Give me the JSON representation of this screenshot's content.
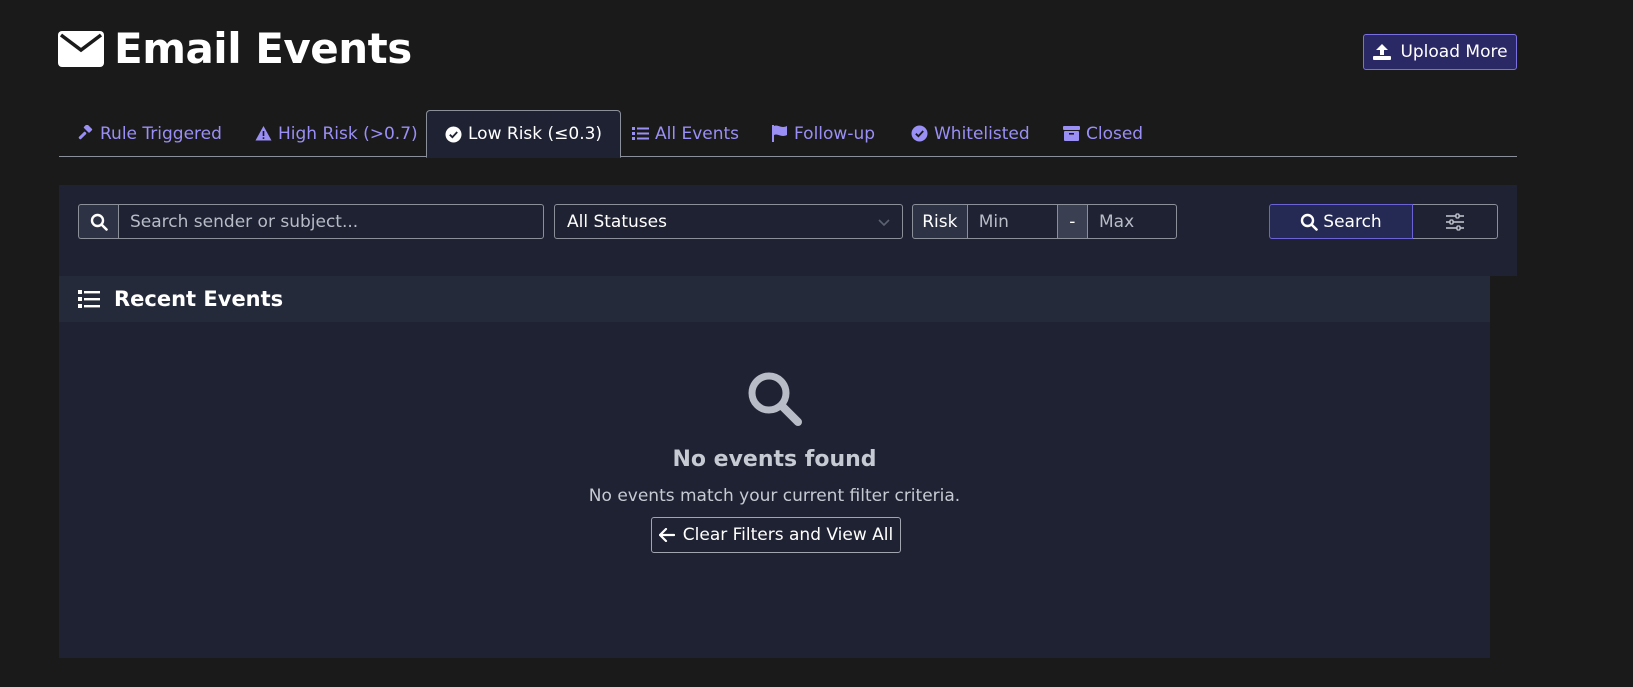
{
  "page": {
    "title": "Email Events",
    "upload_button": "Upload More"
  },
  "tabs": [
    {
      "label": "Rule Triggered",
      "icon": "gavel-icon",
      "active": false
    },
    {
      "label": "High Risk (>0.7)",
      "icon": "warning-icon",
      "active": false
    },
    {
      "label": "Low Risk (≤0.3)",
      "icon": "check-circle-icon",
      "active": true
    },
    {
      "label": "All Events",
      "icon": "list-icon",
      "active": false
    },
    {
      "label": "Follow-up",
      "icon": "flag-icon",
      "active": false
    },
    {
      "label": "Whitelisted",
      "icon": "check-circle-icon",
      "active": false
    },
    {
      "label": "Closed",
      "icon": "archive-icon",
      "active": false
    }
  ],
  "filters": {
    "search_placeholder": "Search sender or subject...",
    "status_selected": "All Statuses",
    "risk_label": "Risk",
    "risk_min_placeholder": "Min",
    "risk_separator": "-",
    "risk_max_placeholder": "Max",
    "search_button": "Search"
  },
  "events": {
    "header": "Recent Events",
    "empty_title": "No events found",
    "empty_message": "No events match your current filter criteria.",
    "clear_button": "Clear Filters and View All"
  },
  "colors": {
    "background": "#1a1a1a",
    "panel": "#1e2232",
    "accent": "#9a8ff5",
    "primary_button": "#252a55"
  }
}
